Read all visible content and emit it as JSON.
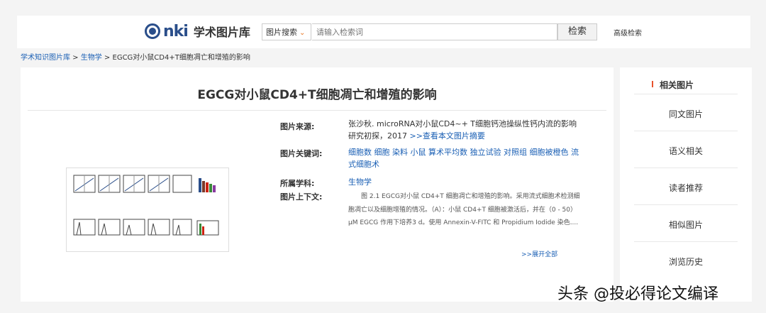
{
  "header": {
    "logo": "CNKI",
    "logo_cnki": "nki",
    "site_title": "学术图片库",
    "search_type": "图片搜索",
    "search_placeholder": "请输入检索词",
    "search_button": "检索",
    "advanced_search": "高级检索"
  },
  "breadcrumb": {
    "root": "学术知识图片库",
    "sep1": " > ",
    "category": "生物学",
    "sep2": " > ",
    "current": "EGCG对小鼠CD4+T细胞凋亡和增殖的影响"
  },
  "main": {
    "title": "EGCG对小鼠CD4+T细胞凋亡和增殖的影响",
    "source_label": "图片来源:",
    "source_text": "张沙秋. microRNA对小鼠CD4~+ T细胞钙池操纵性钙内流的影响研究初探，2017",
    "source_link": ">>查看本文图片摘要",
    "keywords_label": "图片关键词:",
    "keywords": [
      "细胞数",
      "细胞",
      "染料",
      "小鼠",
      "算术平均数",
      "独立试验",
      "对照组",
      "细胞被橙色",
      "流式细胞术"
    ],
    "subject_label": "所属学科:",
    "subject": "生物学",
    "context_label": "图片上下文:",
    "context_text": "图 2.1 EGCG对小鼠 CD4+T 细胞凋亡和增殖的影响。采用流式细胞术检测细胞凋亡以及细胞增殖的情况。（A）：小鼠 CD4+T 细胞被激活后，并在（0 - 50）μM EGCG 作用下培养3 d。使用 Annexin-V-FITC 和 Propidium Iodide 染色....",
    "expand_all": ">>展开全部"
  },
  "sidebar": {
    "heading": "相关图片",
    "items": [
      "同文图片",
      "语义相关",
      "读者推荐",
      "相似图片",
      "浏览历史"
    ]
  },
  "watermark": "头条 @投必得论文编译",
  "colors": {
    "link": "#1a5fb4",
    "accent": "#e8522c",
    "logo": "#2a4e8a",
    "chevron": "#e87722"
  }
}
